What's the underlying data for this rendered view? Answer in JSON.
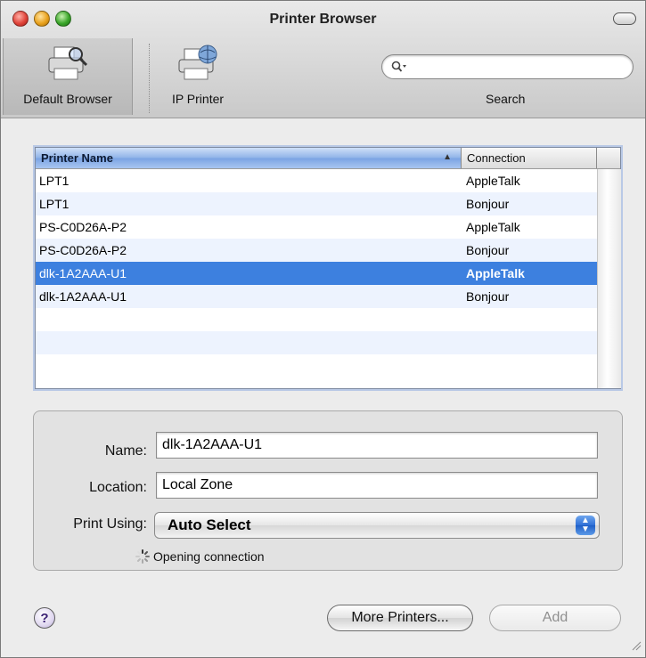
{
  "window": {
    "title": "Printer Browser"
  },
  "toolbar": {
    "items": [
      {
        "label": "Default Browser",
        "icon": "printer-search-icon",
        "selected": true
      },
      {
        "label": "IP Printer",
        "icon": "printer-globe-icon",
        "selected": false
      }
    ],
    "search": {
      "label": "Search",
      "value": "",
      "placeholder": ""
    }
  },
  "table": {
    "columns": [
      "Printer Name",
      "Connection"
    ],
    "sort": {
      "column": "Printer Name",
      "direction": "ascending"
    },
    "rows": [
      {
        "name": "LPT1",
        "connection": "AppleTalk"
      },
      {
        "name": "LPT1",
        "connection": "Bonjour"
      },
      {
        "name": "PS-C0D26A-P2",
        "connection": "AppleTalk"
      },
      {
        "name": "PS-C0D26A-P2",
        "connection": "Bonjour"
      },
      {
        "name": "dlk-1A2AAA-U1",
        "connection": "AppleTalk",
        "selected": true
      },
      {
        "name": "dlk-1A2AAA-U1",
        "connection": "Bonjour"
      }
    ]
  },
  "details": {
    "name_label": "Name:",
    "name_value": "dlk-1A2AAA-U1",
    "location_label": "Location:",
    "location_value": "Local Zone",
    "print_using_label": "Print Using:",
    "print_using_value": "Auto Select",
    "status": "Opening connection"
  },
  "buttons": {
    "help": "?",
    "more_printers": "More Printers...",
    "add": "Add"
  },
  "colors": {
    "selection": "#3d80df",
    "header_sorted": "#8fb3e8"
  }
}
